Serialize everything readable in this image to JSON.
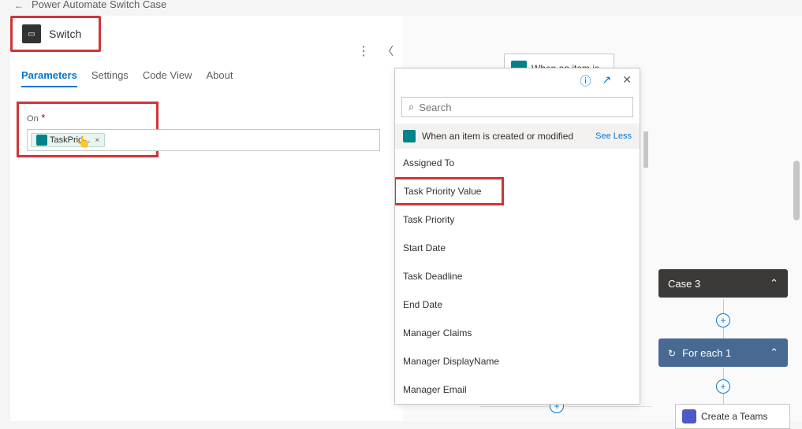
{
  "page": {
    "title": "Power Automate Switch Case"
  },
  "action": {
    "name": "Switch"
  },
  "tabs": {
    "parameters": "Parameters",
    "settings": "Settings",
    "codeview": "Code View",
    "about": "About"
  },
  "onField": {
    "label": "On",
    "chipText": "TaskPrio..."
  },
  "dynamicPanel": {
    "searchPlaceholder": "Search",
    "category": "When an item is created or modified",
    "seeLess": "See Less",
    "items": {
      "assignedTo": "Assigned To",
      "taskPriorityValue": "Task Priority Value",
      "taskPriority": "Task Priority",
      "startDate": "Start Date",
      "taskDeadline": "Task Deadline",
      "endDate": "End Date",
      "managerClaims": "Manager Claims",
      "managerDisplayName": "Manager DisplayName",
      "managerEmail": "Manager Email"
    }
  },
  "canvas": {
    "trigger": "When an item is",
    "case": "Case 3",
    "foreach": "For each 1",
    "teams": "Create a Teams"
  }
}
